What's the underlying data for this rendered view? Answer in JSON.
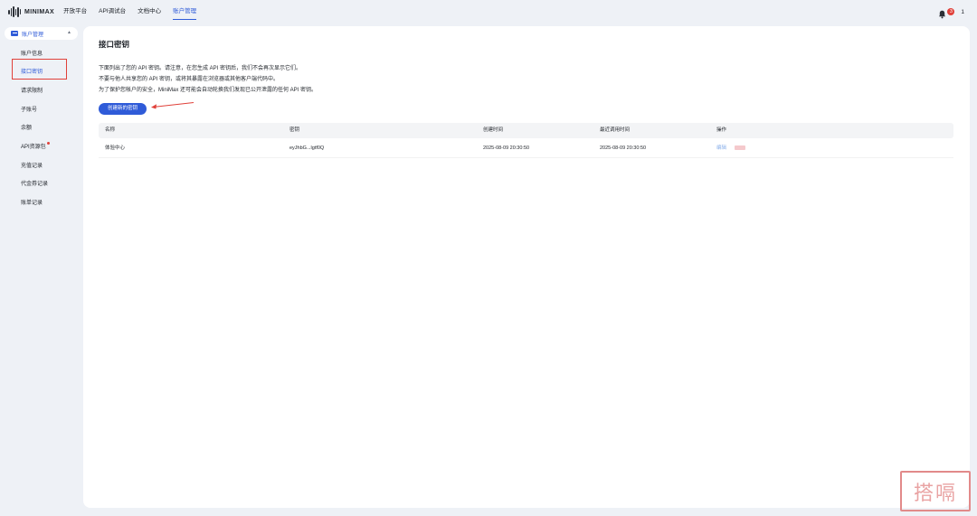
{
  "brand": {
    "name": "MINIMAX"
  },
  "nav": {
    "items": [
      {
        "label": "开放平台"
      },
      {
        "label": "API调试台"
      },
      {
        "label": "文档中心"
      },
      {
        "label": "账户管理"
      }
    ],
    "notification_count": "3",
    "user": "1"
  },
  "sidebar": {
    "group_label": "账户管理",
    "items": [
      {
        "label": "账户信息"
      },
      {
        "label": "接口密钥"
      },
      {
        "label": "请求限制"
      },
      {
        "label": "子账号"
      },
      {
        "label": "余额"
      },
      {
        "label": "API资源包"
      },
      {
        "label": "充值记录"
      },
      {
        "label": "代金券记录"
      },
      {
        "label": "账单记录"
      }
    ]
  },
  "main": {
    "title": "接口密钥",
    "descriptions": [
      "下面列出了您的 API 密钥。请注意，在您生成 API 密钥后，我们不会再次显示它们。",
      "不要与他人共享您的 API 密钥，或将其暴露在浏览器或其他客户端代码中。",
      "为了保护您帐户的安全，MiniMax 还可能会自动轮换我们发现已公开泄露的任何 API 密钥。"
    ],
    "create_button": "创建新的密钥",
    "table": {
      "headers": [
        "名称",
        "密钥",
        "创建时间",
        "最近调用时间",
        "操作"
      ],
      "rows": [
        {
          "name": "体验中心",
          "key": "eyJhbG...lgtf0Q",
          "created": "2025-08-09 20:30:50",
          "last_used": "2025-08-09 20:30:50",
          "edit": "编辑"
        }
      ]
    }
  },
  "watermark": {
    "text": "搭嗝"
  },
  "colors": {
    "accent": "#2f5bd8",
    "highlight": "#e0413a"
  }
}
